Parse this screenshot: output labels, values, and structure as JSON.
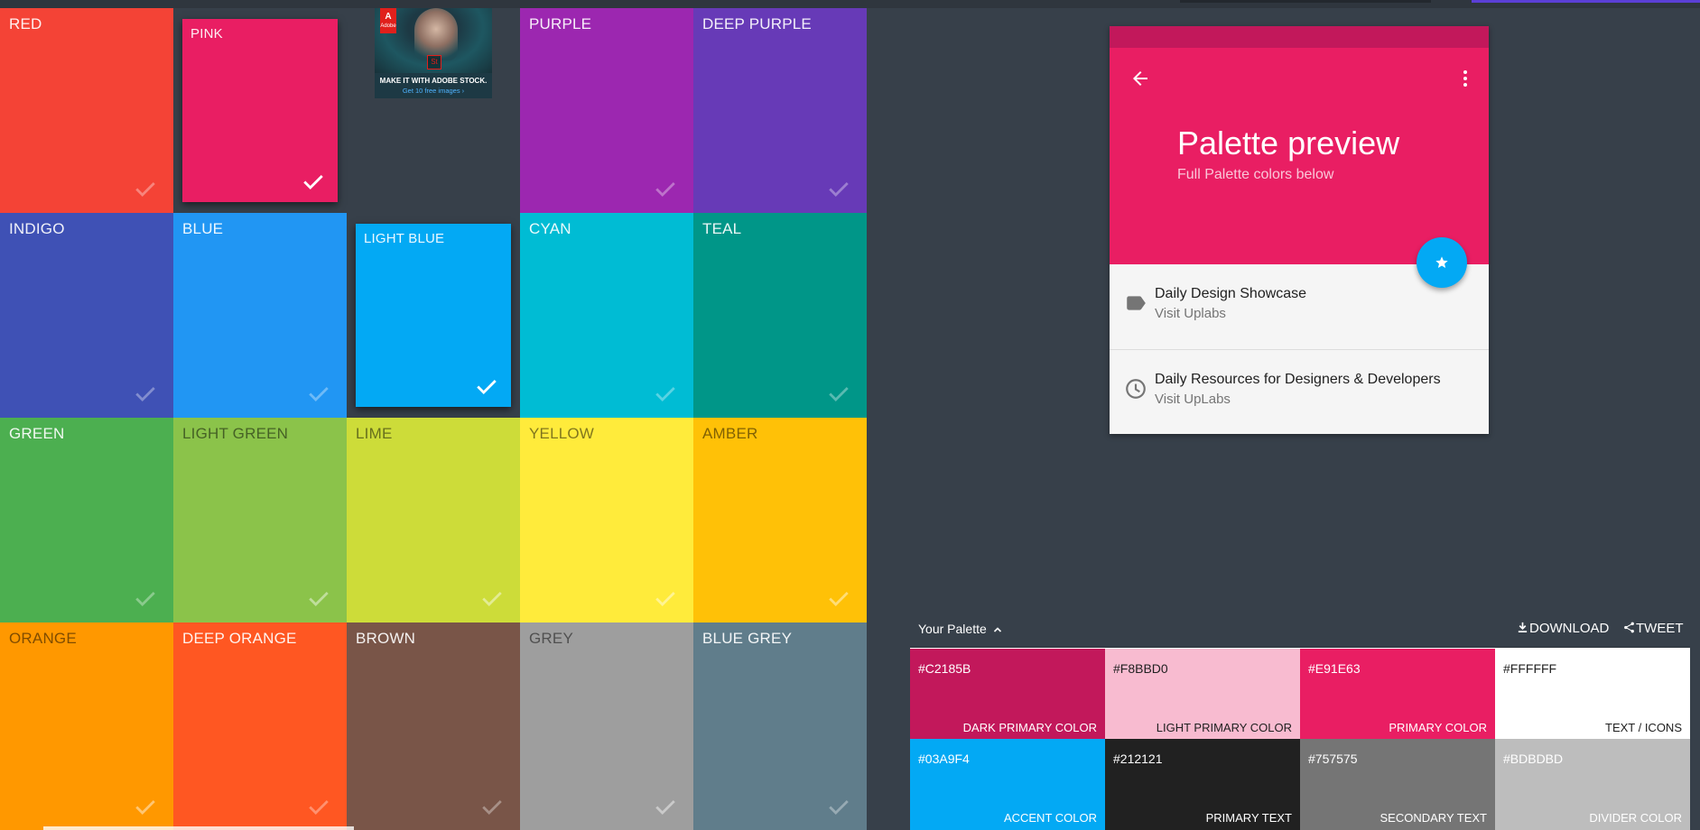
{
  "grid": {
    "tiles": [
      {
        "name": "RED",
        "color": "#F44336",
        "dark": false,
        "selected": false
      },
      {
        "name": "PINK",
        "color": "#E91E63",
        "dark": false,
        "selected": true
      },
      {
        "name": "",
        "color": "",
        "dark": false,
        "selected": false,
        "ad": true
      },
      {
        "name": "PURPLE",
        "color": "#9C27B0",
        "dark": false,
        "selected": false
      },
      {
        "name": "DEEP PURPLE",
        "color": "#673AB7",
        "dark": false,
        "selected": false
      },
      {
        "name": "INDIGO",
        "color": "#3F51B5",
        "dark": false,
        "selected": false
      },
      {
        "name": "BLUE",
        "color": "#2196F3",
        "dark": false,
        "selected": false
      },
      {
        "name": "LIGHT BLUE",
        "color": "#03A9F4",
        "dark": false,
        "selected": true
      },
      {
        "name": "CYAN",
        "color": "#00BCD4",
        "dark": false,
        "selected": false
      },
      {
        "name": "TEAL",
        "color": "#009688",
        "dark": false,
        "selected": false
      },
      {
        "name": "GREEN",
        "color": "#4CAF50",
        "dark": false,
        "selected": false
      },
      {
        "name": "LIGHT GREEN",
        "color": "#8BC34A",
        "dark": true,
        "selected": false
      },
      {
        "name": "LIME",
        "color": "#CDDC39",
        "dark": true,
        "selected": false
      },
      {
        "name": "YELLOW",
        "color": "#FFEB3B",
        "dark": true,
        "selected": false
      },
      {
        "name": "AMBER",
        "color": "#FFC107",
        "dark": true,
        "selected": false
      },
      {
        "name": "ORANGE",
        "color": "#FF9800",
        "dark": true,
        "selected": false
      },
      {
        "name": "DEEP ORANGE",
        "color": "#FF5722",
        "dark": false,
        "selected": false
      },
      {
        "name": "BROWN",
        "color": "#795548",
        "dark": false,
        "selected": false
      },
      {
        "name": "GREY",
        "color": "#9E9E9E",
        "dark": true,
        "selected": false
      },
      {
        "name": "BLUE GREY",
        "color": "#607D8B",
        "dark": false,
        "selected": false
      }
    ]
  },
  "ad": {
    "brand": "Adobe",
    "product": "St",
    "headline": "MAKE IT WITH ADOBE STOCK.",
    "cta": "Get 10 free images ›"
  },
  "preview": {
    "title": "Palette preview",
    "subtitle": "Full Palette colors below",
    "items": [
      {
        "title": "Daily Design Showcase",
        "subtitle": "Visit Uplabs",
        "icon": "label-icon"
      },
      {
        "title": "Daily Resources for Designers & Developers",
        "subtitle": "Visit UpLabs",
        "icon": "clock-icon"
      }
    ],
    "colors": {
      "dark_primary": "#C2185B",
      "primary": "#E91E63",
      "accent": "#03A9F4"
    }
  },
  "palette": {
    "title": "Your Palette",
    "download_label": "DOWNLOAD",
    "tweet_label": "TWEET",
    "swatches": [
      {
        "hex": "#C2185B",
        "role": "DARK PRIMARY COLOR",
        "fg": "#FFFFFF"
      },
      {
        "hex": "#F8BBD0",
        "role": "LIGHT PRIMARY COLOR",
        "fg": "#212121"
      },
      {
        "hex": "#E91E63",
        "role": "PRIMARY COLOR",
        "fg": "#FFFFFF"
      },
      {
        "hex": "#FFFFFF",
        "role": "TEXT / ICONS",
        "fg": "#212121"
      },
      {
        "hex": "#03A9F4",
        "role": "ACCENT COLOR",
        "fg": "#FFFFFF"
      },
      {
        "hex": "#212121",
        "role": "PRIMARY TEXT",
        "fg": "#FFFFFF"
      },
      {
        "hex": "#757575",
        "role": "SECONDARY TEXT",
        "fg": "#FFFFFF"
      },
      {
        "hex": "#BDBDBD",
        "role": "DIVIDER COLOR",
        "fg": "#FFFFFF"
      }
    ]
  }
}
